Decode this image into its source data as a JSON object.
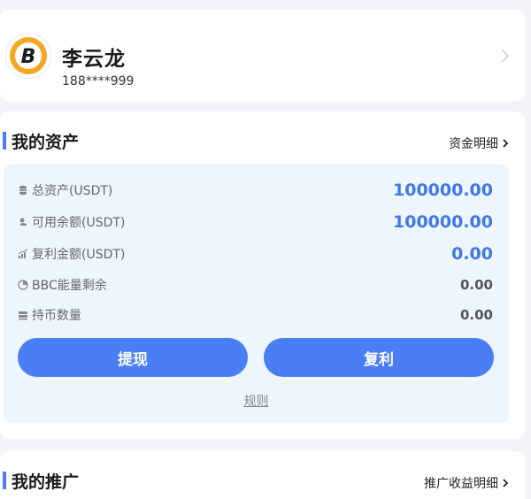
{
  "profile": {
    "name": "李云龙",
    "phone": "188****999"
  },
  "assets": {
    "title": "我的资产",
    "link_label": "资金明细",
    "rows": [
      {
        "label": "总资产(USDT)",
        "value": "100000.00",
        "icon": "coins-stack-icon"
      },
      {
        "label": "可用余额(USDT)",
        "value": "100000.00",
        "icon": "wallet-icon"
      },
      {
        "label": "复利金额(USDT)",
        "value": "0.00",
        "icon": "chart-icon"
      },
      {
        "label": "BBC能量剩余",
        "value": "0.00",
        "icon": "pie-chart-icon"
      },
      {
        "label": "持币数量",
        "value": "0.00",
        "icon": "coins-icon"
      }
    ],
    "withdraw_label": "提现",
    "compound_label": "复利",
    "rules_label": "规则"
  },
  "promotion": {
    "title": "我的推广",
    "link_label": "推广收益明细"
  },
  "colors": {
    "accent": "#4a7ef5",
    "value_blue": "#3f78e8",
    "panel_bg": "#eef6fd",
    "page_bg": "#f2f4f7"
  }
}
